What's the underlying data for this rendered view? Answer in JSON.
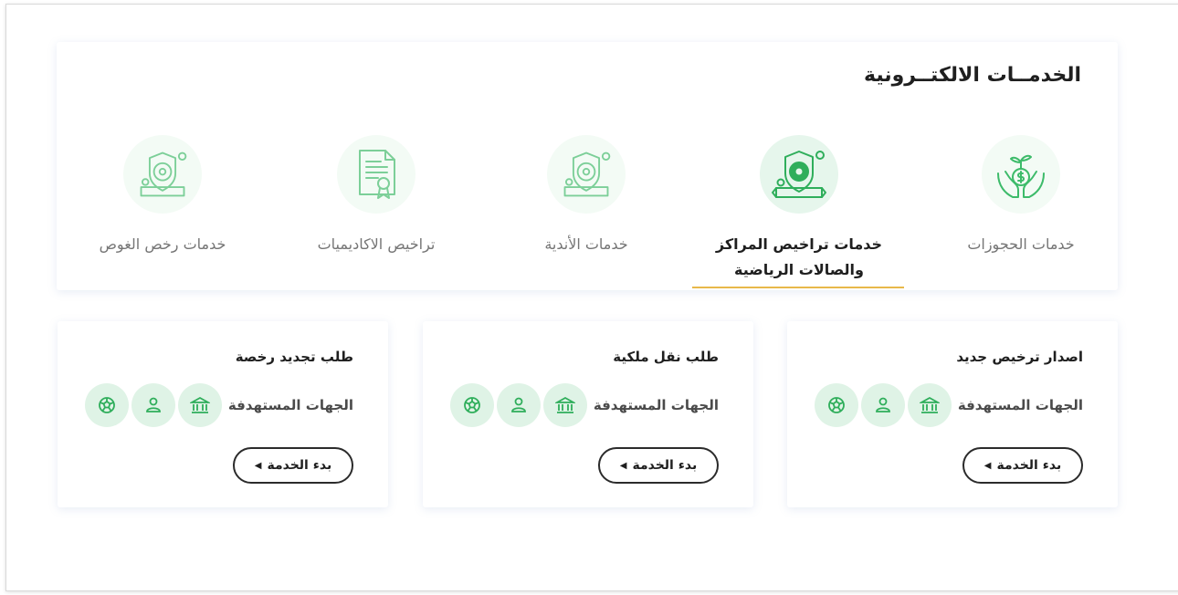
{
  "section": {
    "title": "الخدمــات الالكتــرونية"
  },
  "tabs": [
    {
      "label": "خدمات الحجوزات",
      "icon": "hands-money-icon",
      "active": false
    },
    {
      "label": "خدمات تراخيص المراكز والصالات الرياضية",
      "icon": "sports-license-shield-icon",
      "active": true
    },
    {
      "label": "خدمات الأندية",
      "icon": "club-shield-icon",
      "active": false
    },
    {
      "label": "تراخيص الاكاديميات",
      "icon": "certificate-document-icon",
      "active": false
    },
    {
      "label": "خدمات رخص الغوص",
      "icon": "diving-license-shield-icon",
      "active": false
    }
  ],
  "cards": [
    {
      "title": "اصدار ترخيص جديد",
      "targets_label": "الجهات المستهدفة",
      "button": "بدء الخدمة"
    },
    {
      "title": "طلب نقل ملكية",
      "targets_label": "الجهات المستهدفة",
      "button": "بدء الخدمة"
    },
    {
      "title": "طلب تجديد رخصة",
      "targets_label": "الجهات المستهدفة",
      "button": "بدء الخدمة"
    }
  ],
  "target_icons": [
    "government-building-icon",
    "person-icon",
    "football-icon"
  ],
  "colors": {
    "accent_green": "#2fae5b",
    "icon_bg": "#dff3e6",
    "active_underline": "#e8b84a"
  }
}
